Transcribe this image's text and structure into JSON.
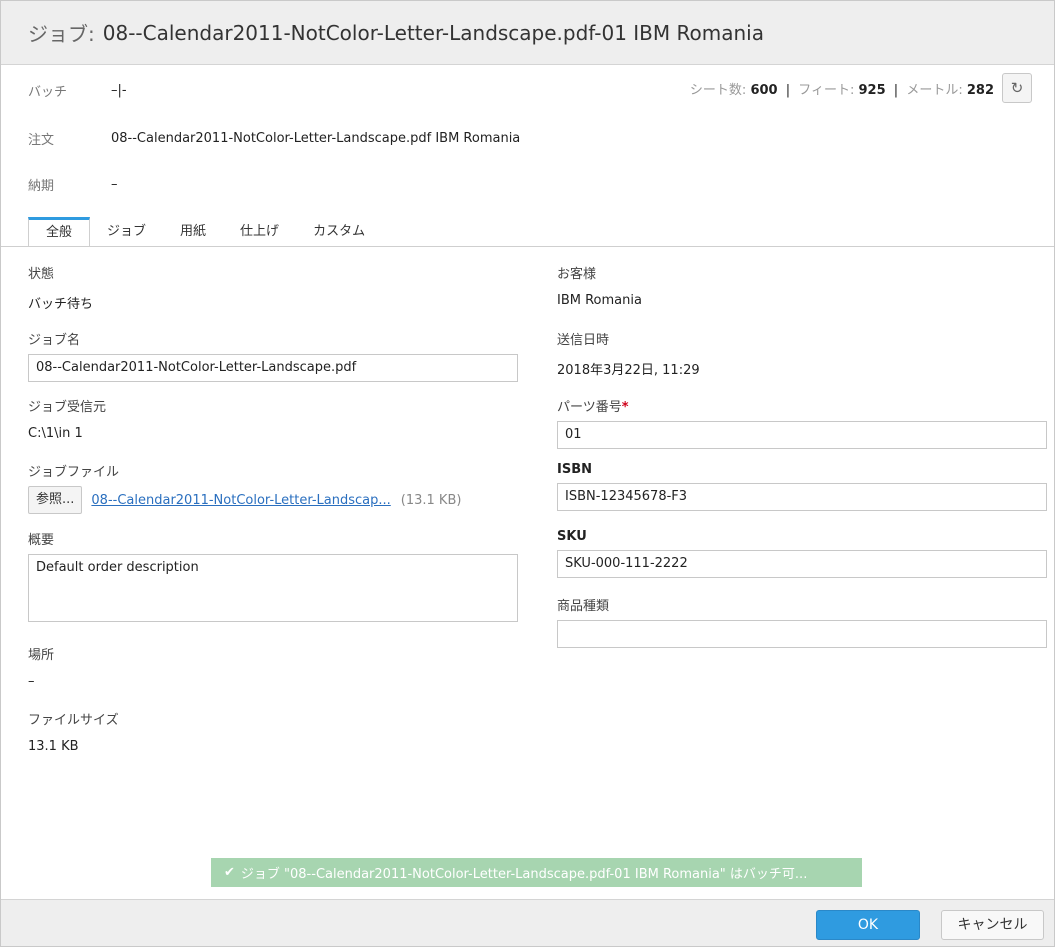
{
  "title": {
    "label": "ジョブ:",
    "name": "08--Calendar2011-NotColor-Letter-Landscape.pdf-01 IBM Romania"
  },
  "info": {
    "batch_label": "バッチ",
    "batch_value": "–|-",
    "order_label": "注文",
    "order_value": "08--Calendar2011-NotColor-Letter-Landscape.pdf IBM Romania",
    "due_label": "納期",
    "due_value": "–",
    "sheets_label": "シート数:",
    "sheets_value": "600",
    "feet_label": "フィート:",
    "feet_value": "925",
    "meters_label": "メートル:",
    "meters_value": "282",
    "separator": "|",
    "refresh_icon": "refresh-icon"
  },
  "tabs": [
    {
      "label": "全般",
      "active": true
    },
    {
      "label": "ジョブ",
      "active": false
    },
    {
      "label": "用紙",
      "active": false
    },
    {
      "label": "仕上げ",
      "active": false
    },
    {
      "label": "カスタム",
      "active": false
    }
  ],
  "left": {
    "status_label": "状態",
    "status_value": "バッチ待ち",
    "jobname_label": "ジョブ名",
    "jobname_value": "08--Calendar2011-NotColor-Letter-Landscape.pdf",
    "source_label": "ジョブ受信元",
    "source_value": "C:\\1\\in 1",
    "jobfile_label": "ジョブファイル",
    "browse_label": "参照...",
    "file_link": "08--Calendar2011-NotColor-Letter-Landscap...",
    "file_size": "(13.1 KB)",
    "summary_label": "概要",
    "summary_value": "Default order description",
    "location_label": "場所",
    "location_value": "–",
    "filesize_label": "ファイルサイズ",
    "filesize_value": "13.1 KB"
  },
  "right": {
    "customer_label": "お客様",
    "customer_value": "IBM Romania",
    "sent_label": "送信日時",
    "sent_value": "2018年3月22日, 11:29",
    "part_label": "パーツ番号",
    "part_required": "*",
    "part_value": "01",
    "isbn_label": "ISBN",
    "isbn_value": "ISBN-12345678-F3",
    "sku_label": "SKU",
    "sku_value": "SKU-000-111-2222",
    "product_label": "商品種類",
    "product_value": ""
  },
  "toast": {
    "icon": "check-icon",
    "text": "ジョブ \"08--Calendar2011-NotColor-Letter-Landscape.pdf-01 IBM Romania\" はバッチ可..."
  },
  "footer": {
    "ok_label": "OK",
    "cancel_label": "キャンセル"
  },
  "colors": {
    "accent": "#2f9be0",
    "toast": "#a7d5b0",
    "link": "#2a6fbf",
    "required": "#d0021b"
  }
}
